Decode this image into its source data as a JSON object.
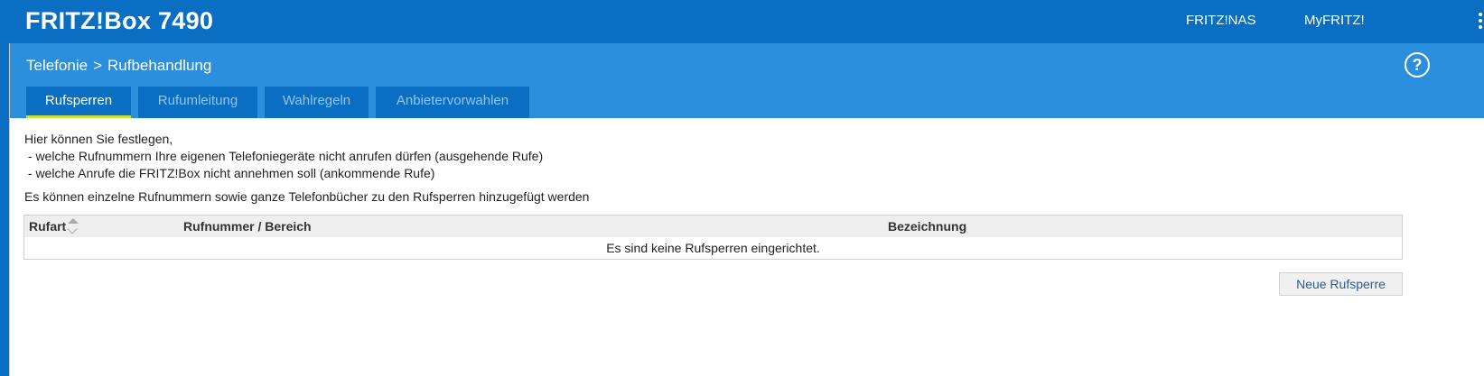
{
  "header": {
    "brand": "FRITZ!Box 7490",
    "links": [
      {
        "label": "FRITZ!NAS"
      },
      {
        "label": "MyFRITZ!"
      }
    ]
  },
  "breadcrumb": {
    "parent": "Telefonie",
    "separator": ">",
    "current": "Rufbehandlung"
  },
  "help": {
    "label": "?"
  },
  "tabs": [
    {
      "label": "Rufsperren",
      "active": true
    },
    {
      "label": "Rufumleitung",
      "active": false
    },
    {
      "label": "Wahlregeln",
      "active": false
    },
    {
      "label": "Anbietervorwahlen",
      "active": false
    }
  ],
  "intro": {
    "line1": "Hier können Sie festlegen,",
    "line2": " - welche Rufnummern Ihre eigenen Telefoniegeräte nicht anrufen dürfen (ausgehende Rufe)",
    "line3": " - welche Anrufe die FRITZ!Box nicht annehmen soll (ankommende Rufe)",
    "line4": "Es können einzelne Rufnummern sowie ganze Telefonbücher zu den Rufsperren hinzugefügt werden"
  },
  "table": {
    "columns": [
      "Rufart",
      "Rufnummer / Bereich",
      "Bezeichnung"
    ],
    "empty_message": "Es sind keine Rufsperren eingerichtet."
  },
  "actions": {
    "new_block": "Neue Rufsperre"
  },
  "colors": {
    "topbar": "#0a6fc2",
    "subheader": "#2b8fde",
    "tab_active_underline": "#c6e23b"
  }
}
